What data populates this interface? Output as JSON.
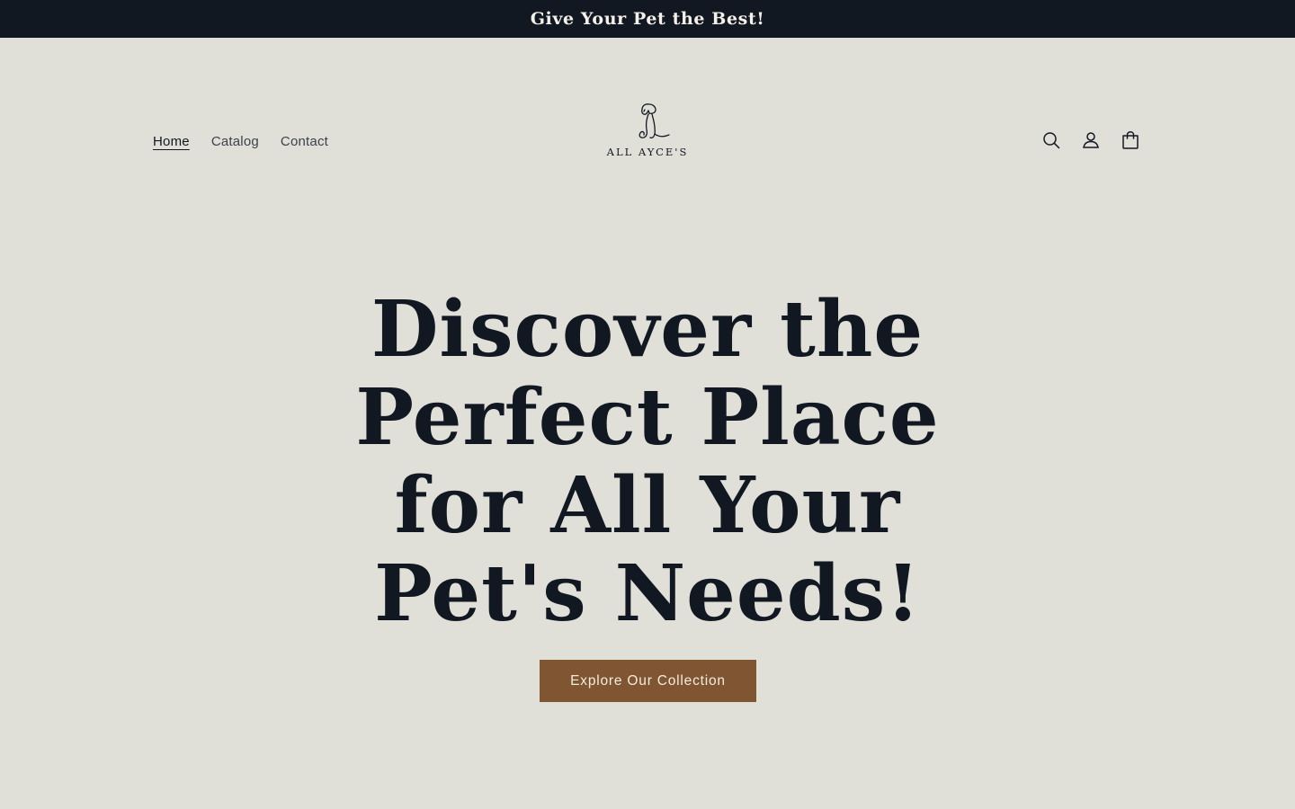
{
  "announcement": {
    "text": "Give Your Pet the Best!"
  },
  "nav": {
    "items": [
      {
        "label": "Home"
      },
      {
        "label": "Catalog"
      },
      {
        "label": "Contact"
      }
    ]
  },
  "logo": {
    "text": "ALL AYCE'S",
    "icon": "dog-line-art-icon"
  },
  "header_icons": [
    "search-icon",
    "account-icon",
    "cart-icon"
  ],
  "hero": {
    "heading": "Discover the Perfect Place for All Your Pet's Needs!",
    "cta_label": "Explore Our Collection"
  },
  "colors": {
    "background": "#e0e0d9",
    "announcement_bg": "#121821",
    "text": "#121821",
    "cta_bg": "#7f5631"
  }
}
